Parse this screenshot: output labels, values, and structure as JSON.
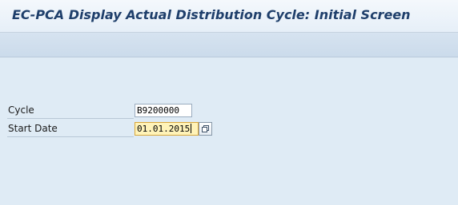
{
  "window": {
    "title": "EC-PCA Display Actual Distribution Cycle: Initial Screen"
  },
  "form": {
    "cycle": {
      "label": "Cycle",
      "value": "B9200000"
    },
    "start_date": {
      "label": "Start Date",
      "value": "01.01.2015",
      "help_icon": "value-help-icon"
    }
  },
  "colors": {
    "title_text": "#1f3f6b",
    "background": "#dfebf5",
    "focused_field": "#fff3b8"
  }
}
